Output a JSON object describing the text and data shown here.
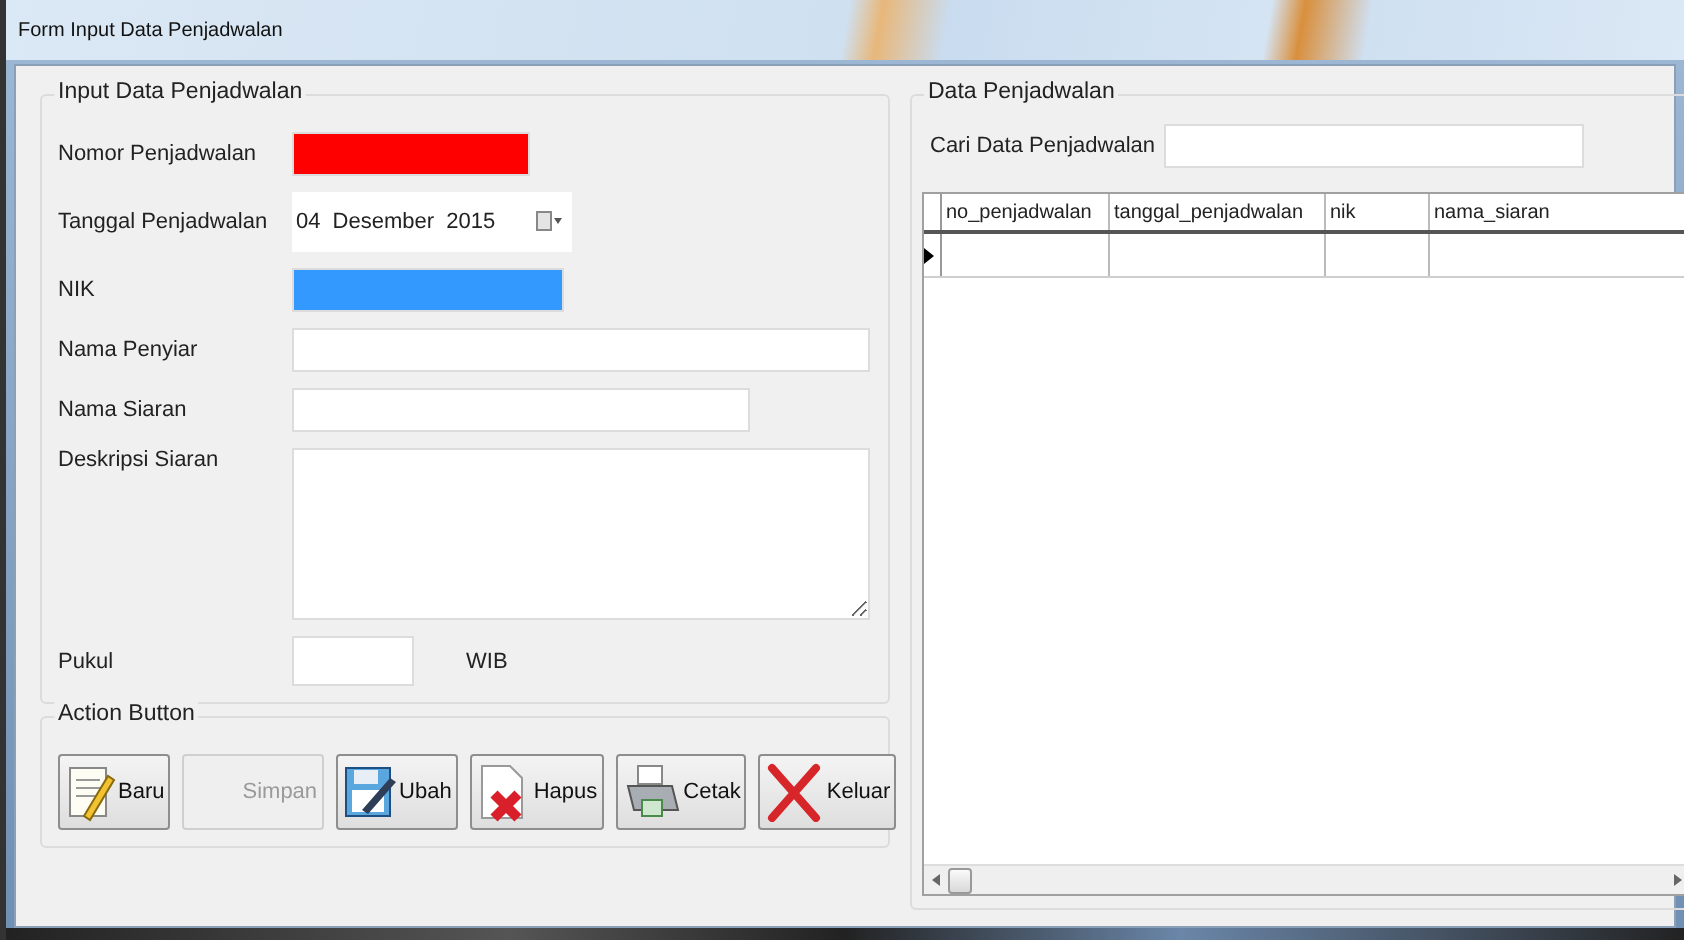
{
  "window": {
    "title": "Form Input Data Penjadwalan"
  },
  "input_group": {
    "title": "Input Data Penjadwalan",
    "fields": [
      {
        "kind": "text",
        "label": "Nomor Penjadwalan",
        "color": "#ff0000"
      },
      {
        "kind": "date",
        "label": "Tanggal Penjadwalan",
        "value": "04 Desember 2015"
      },
      {
        "kind": "text",
        "label": "NIK",
        "color": "#3399ff"
      },
      {
        "kind": "text",
        "label": "Nama Penyiar"
      },
      {
        "kind": "text",
        "label": "Nama Siaran"
      },
      {
        "kind": "textarea",
        "label": "Deskripsi Siaran"
      },
      {
        "kind": "time",
        "label": "Pukul",
        "suffix": "WIB"
      }
    ]
  },
  "action_group": {
    "title": "Action Button",
    "buttons": [
      {
        "label": "Baru",
        "kind": "new",
        "disabled": false
      },
      {
        "label": "Simpan",
        "kind": "save",
        "disabled": true
      },
      {
        "label": "Ubah",
        "kind": "edit",
        "disabled": false
      },
      {
        "label": "Hapus",
        "kind": "delete",
        "disabled": false
      },
      {
        "label": "Cetak",
        "kind": "print",
        "disabled": false
      },
      {
        "label": "Keluar",
        "kind": "exit",
        "disabled": false
      }
    ]
  },
  "data_group": {
    "title": "Data Penjadwalan",
    "search": {
      "label": "Cari Data Penjadwalan"
    },
    "table": {
      "columns": [
        "no_penjadwalan",
        "tanggal_penjadwalan",
        "nik",
        "nama_siaran"
      ],
      "rows": [
        {
          "current": true
        }
      ]
    }
  }
}
